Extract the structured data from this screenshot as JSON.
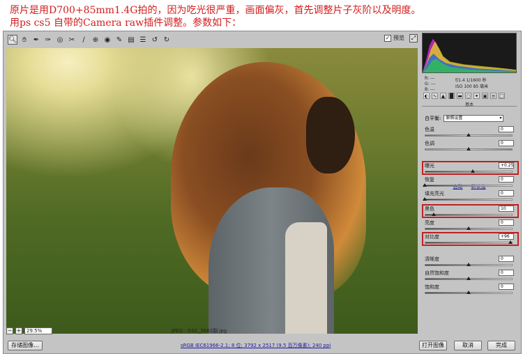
{
  "captions": {
    "line1": "原片是用D700+85mm1.4G拍的，因为吃光很严重，画面偏灰，首先调整片子灰阶以及明度。",
    "line2": "用ps cs5 自带的Camera raw插件调整。参数如下："
  },
  "toolbar": {
    "tools": [
      "zoom-icon",
      "hand-icon",
      "eyedropper-icon",
      "color-sampler-icon",
      "target-icon",
      "crop-icon",
      "straighten-icon",
      "spot-removal-icon",
      "red-eye-icon",
      "brush-icon",
      "gradient-icon",
      "prefs-icon",
      "rotate-ccw-icon",
      "rotate-cw-icon"
    ],
    "preview_label": "预览"
  },
  "status": {
    "zoom_value": "29.5%",
    "filename": "JPEG - DSC_5662副.jpg"
  },
  "bottom": {
    "save_label": "存储图像...",
    "info_link": "sRGB IEC61966-2.1; 8 位; 3792 x 2517 (9.5 百万像素); 240 ppi",
    "open_label": "打开图像",
    "cancel_label": "取消",
    "done_label": "完成"
  },
  "panel": {
    "rgb": {
      "r": "R:  ---",
      "g": "G:  ---",
      "b": "B:  ---"
    },
    "exif_line1": "f/1.4  1/1600 秒",
    "exif_line2": "ISO 100  85 毫米",
    "header": "基本",
    "wb_label": "白平衡:",
    "wb_value": "原照设置",
    "auto_label": "自动",
    "default_label": "默认值",
    "sliders": [
      {
        "label": "色温",
        "value": "0",
        "level": 0.5
      },
      {
        "label": "色调",
        "value": "0",
        "level": 0.5
      },
      {
        "label": "曝光",
        "value": "+0.25",
        "level": 0.55,
        "highlighted": true
      },
      {
        "label": "恢复",
        "value": "0",
        "level": 0.0
      },
      {
        "label": "填充亮光",
        "value": "0",
        "level": 0.0
      },
      {
        "label": "黑色",
        "value": "10",
        "level": 0.1,
        "highlighted": true
      },
      {
        "label": "亮度",
        "value": "0",
        "level": 0.5
      },
      {
        "label": "对比度",
        "value": "+96",
        "level": 0.98,
        "highlighted": true
      },
      {
        "label": "清晰度",
        "value": "0",
        "level": 0.5
      },
      {
        "label": "自然饱和度",
        "value": "0",
        "level": 0.5
      },
      {
        "label": "饱和度",
        "value": "0",
        "level": 0.5
      }
    ]
  },
  "colors": {
    "caption": "#d21c1c",
    "highlight": "#c02020",
    "link": "#1a1aa0"
  }
}
